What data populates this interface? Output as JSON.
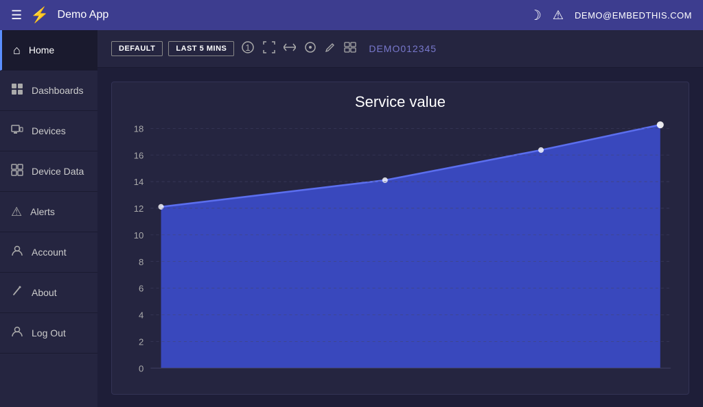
{
  "header": {
    "app_title": "Demo App",
    "user_email": "DEMO@EMBEDTHIS.COM",
    "hamburger_label": "≡",
    "lightning_symbol": "⚡",
    "moon_symbol": ")",
    "alert_symbol": "⚠"
  },
  "sidebar": {
    "items": [
      {
        "label": "Home",
        "icon": "🏠",
        "id": "home",
        "active": true
      },
      {
        "label": "Dashboards",
        "icon": "📊",
        "id": "dashboards",
        "active": false
      },
      {
        "label": "Devices",
        "icon": "📱",
        "id": "devices",
        "active": false
      },
      {
        "label": "Device Data",
        "icon": "⊞",
        "id": "device-data",
        "active": false
      },
      {
        "label": "Alerts",
        "icon": "⚠",
        "id": "alerts",
        "active": false
      },
      {
        "label": "Account",
        "icon": "👤",
        "id": "account",
        "active": false
      },
      {
        "label": "About",
        "icon": "✏",
        "id": "about",
        "active": false
      },
      {
        "label": "Log Out",
        "icon": "👤",
        "id": "logout",
        "active": false
      }
    ]
  },
  "toolbar": {
    "btn_default": "DEFAULT",
    "btn_last5": "LAST 5 MINS",
    "device_id": "DEMO012345"
  },
  "chart": {
    "title": "Service value",
    "y_labels": [
      "0",
      "2",
      "4",
      "6",
      "8",
      "10",
      "12",
      "14",
      "16",
      "18"
    ],
    "data_points": [
      {
        "x": 0.02,
        "y": 12
      },
      {
        "x": 0.45,
        "y": 14
      },
      {
        "x": 0.75,
        "y": 16.2
      },
      {
        "x": 0.98,
        "y": 18.2
      }
    ],
    "y_min": 0,
    "y_max": 20
  },
  "colors": {
    "header_bg": "#3d3d8f",
    "sidebar_bg": "#252540",
    "content_bg": "#1e1e38",
    "chart_fill": "#3b4bc8",
    "chart_line": "#5b6eee",
    "active_border": "#5b8fff"
  }
}
